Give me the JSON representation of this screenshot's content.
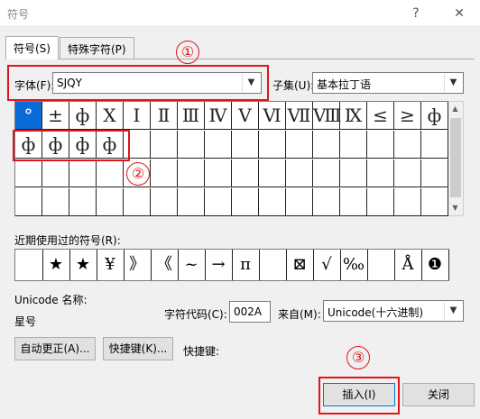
{
  "window": {
    "title": "符号",
    "help_glyph": "?",
    "close_glyph": "✕"
  },
  "tabs": [
    {
      "label": "符号(S)"
    },
    {
      "label": "特殊字符(P)"
    }
  ],
  "font": {
    "label": "字体(F):",
    "value": "SJQY"
  },
  "subset": {
    "label": "子集(U):",
    "value": "基本拉丁语"
  },
  "grid_symbols": [
    [
      "°",
      "±",
      "ф",
      "Ⅹ",
      "Ⅰ",
      "Ⅱ",
      "Ⅲ",
      "Ⅳ",
      "Ⅴ",
      "Ⅵ",
      "Ⅶ",
      "Ⅷ",
      "Ⅸ",
      "≤",
      "≥",
      "ф"
    ],
    [
      "ф",
      "ф",
      "ф",
      "ф",
      "",
      "",
      "",
      "",
      "",
      "",
      "",
      "",
      "",
      "",
      "",
      ""
    ],
    [
      "",
      "",
      "",
      "",
      "",
      "",
      "",
      "",
      "",
      "",
      "",
      "",
      "",
      "",
      "",
      ""
    ],
    [
      "",
      "",
      "",
      "",
      "",
      "",
      "",
      "",
      "",
      "",
      "",
      "",
      "",
      "",
      "",
      ""
    ]
  ],
  "recent": {
    "label": "近期使用过的符号(R):",
    "symbols": [
      "",
      "★",
      "★",
      "¥",
      "》",
      "《",
      "~",
      "→",
      "π",
      "",
      "⊠",
      "√",
      "‰",
      "",
      "Å",
      "❶"
    ]
  },
  "unicode_name": {
    "label": "Unicode 名称:",
    "value": "星号"
  },
  "char_code": {
    "label": "字符代码(C):",
    "value": "002A"
  },
  "from": {
    "label": "来自(M):",
    "value": "Unicode(十六进制)"
  },
  "buttons": {
    "autocorrect": "自动更正(A)...",
    "shortcut_key": "快捷键(K)...",
    "shortcut_label": "快捷键:",
    "insert": "插入(I)",
    "close": "关闭"
  },
  "markers": [
    "①",
    "②",
    "③"
  ],
  "colors": {
    "annotation_red": "#e0161a",
    "selection_blue": "#0a6cd8"
  }
}
